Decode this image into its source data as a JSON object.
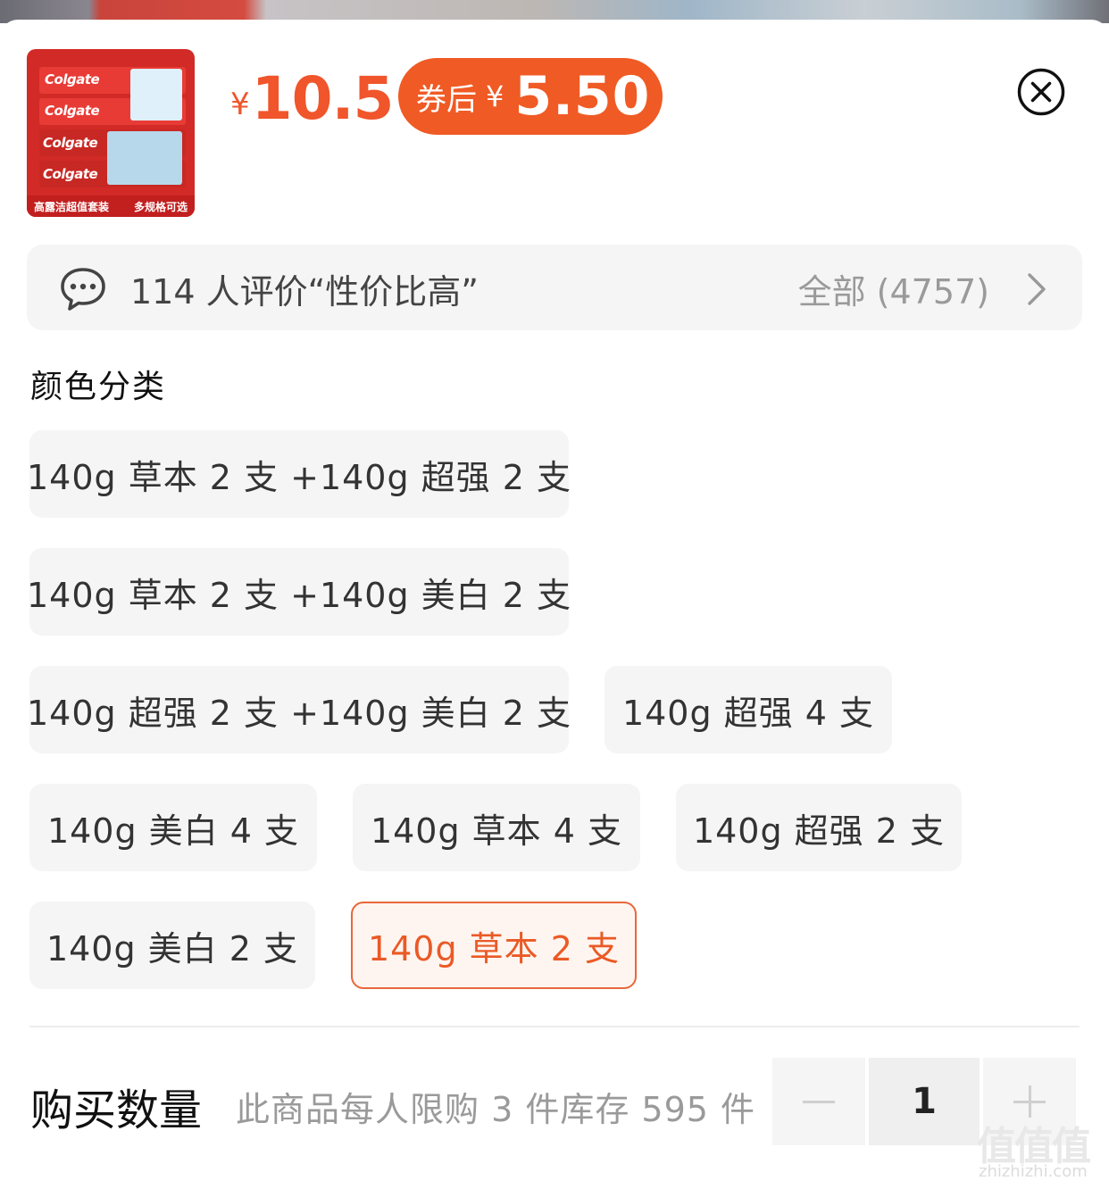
{
  "product": {
    "thumb_brand": "Colgate",
    "thumb_tag_left": "高露洁超值套装",
    "thumb_tag_right": "多规格可选",
    "currency_symbol": "¥",
    "price": "10.5",
    "coupon_label": "券后",
    "coupon_currency": "¥",
    "coupon_price": "5.50"
  },
  "close_icon": "close-circle-icon",
  "reviews": {
    "summary": "114 人评价“性价比高”",
    "all_label": "全部 (4757)"
  },
  "variants": {
    "title": "颜色分类",
    "options": [
      {
        "label": "140g 草本 2 支 +140g 超强 2 支",
        "selected": false
      },
      {
        "label": "140g 草本 2 支 +140g 美白 2 支",
        "selected": false
      },
      {
        "label": "140g 超强 2 支 +140g 美白 2 支",
        "selected": false
      },
      {
        "label": "140g 超强 4 支",
        "selected": false
      },
      {
        "label": "140g 美白 4 支",
        "selected": false
      },
      {
        "label": "140g 草本 4 支",
        "selected": false
      },
      {
        "label": "140g 超强 2 支",
        "selected": false
      },
      {
        "label": "140g 美白 2 支",
        "selected": false
      },
      {
        "label": "140g 草本 2 支",
        "selected": true
      }
    ]
  },
  "quantity": {
    "label": "购买数量",
    "note": "此商品每人限购 3 件库存 595 件",
    "value": "1"
  },
  "watermark": {
    "main": "值值值",
    "sub": "zhizhizhi.com"
  },
  "colors": {
    "accent": "#f0552b",
    "chip_bg": "#f5f5f5",
    "selected_border": "#e8673a"
  }
}
